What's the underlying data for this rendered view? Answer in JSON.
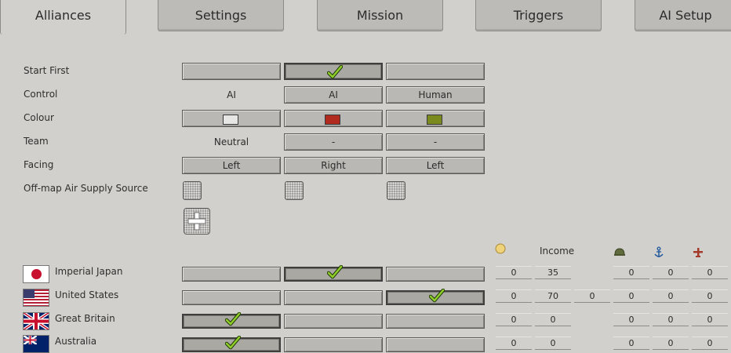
{
  "tabs": [
    {
      "label": "Alliances",
      "active": true
    },
    {
      "label": "Settings",
      "active": false
    },
    {
      "label": "Mission",
      "active": false
    },
    {
      "label": "Triggers",
      "active": false
    },
    {
      "label": "AI Setup",
      "active": false
    }
  ],
  "rows": {
    "start_first": "Start First",
    "control": "Control",
    "colour": "Colour",
    "team": "Team",
    "facing": "Facing",
    "air_supply": "Off-map Air Supply Source"
  },
  "alliances": [
    {
      "start_first": false,
      "control": "AI",
      "colour": "#e6e6e4",
      "team": "Neutral",
      "facing": "Left"
    },
    {
      "start_first": true,
      "control": "AI",
      "colour": "#b02a1e",
      "team": "-",
      "facing": "Right"
    },
    {
      "start_first": false,
      "control": "Human",
      "colour": "#7a8a1e",
      "team": "-",
      "facing": "Left"
    }
  ],
  "resources": {
    "income_label": "Income",
    "icons": [
      "coin-icon",
      "helmet-icon",
      "anchor-icon",
      "plane-icon"
    ],
    "icon_colors": {
      "coin": "#e8c35a",
      "helmet": "#5f6b3c",
      "anchor": "#2c5fa0",
      "plane": "#a33a2a"
    }
  },
  "countries": [
    {
      "name": "Imperial Japan",
      "flag": "japan-flag",
      "alliance": 1,
      "values": [
        "0",
        "35",
        "",
        "0",
        "0",
        "0"
      ]
    },
    {
      "name": "United States",
      "flag": "usa-flag",
      "alliance": 2,
      "values": [
        "0",
        "70",
        "0",
        "0",
        "0",
        "0"
      ]
    },
    {
      "name": "Great Britain",
      "flag": "uk-flag",
      "alliance": 0,
      "values": [
        "0",
        "0",
        "",
        "0",
        "0",
        "0"
      ]
    },
    {
      "name": "Australia",
      "flag": "australia-flag",
      "alliance": 0,
      "values": [
        "0",
        "0",
        "",
        "0",
        "0",
        "0"
      ]
    }
  ]
}
